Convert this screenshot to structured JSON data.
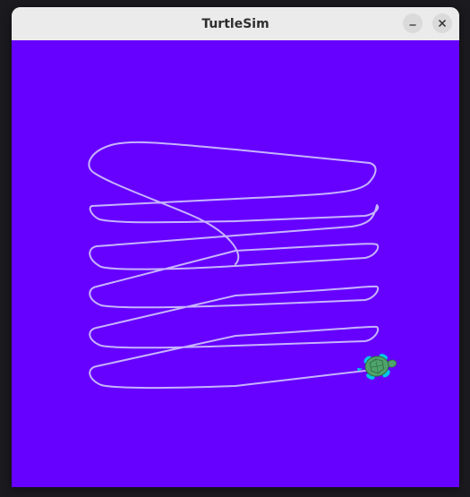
{
  "window": {
    "title": "TurtleSim"
  },
  "titlebar_buttons": {
    "minimize_icon": "minimize-icon",
    "close_icon": "close-icon"
  },
  "canvas": {
    "background_color": "#6600ff",
    "pen_color": "#c7b3ff",
    "turtle_shell_color": "#4ea36b",
    "turtle_limb_color": "#00c8e6"
  }
}
